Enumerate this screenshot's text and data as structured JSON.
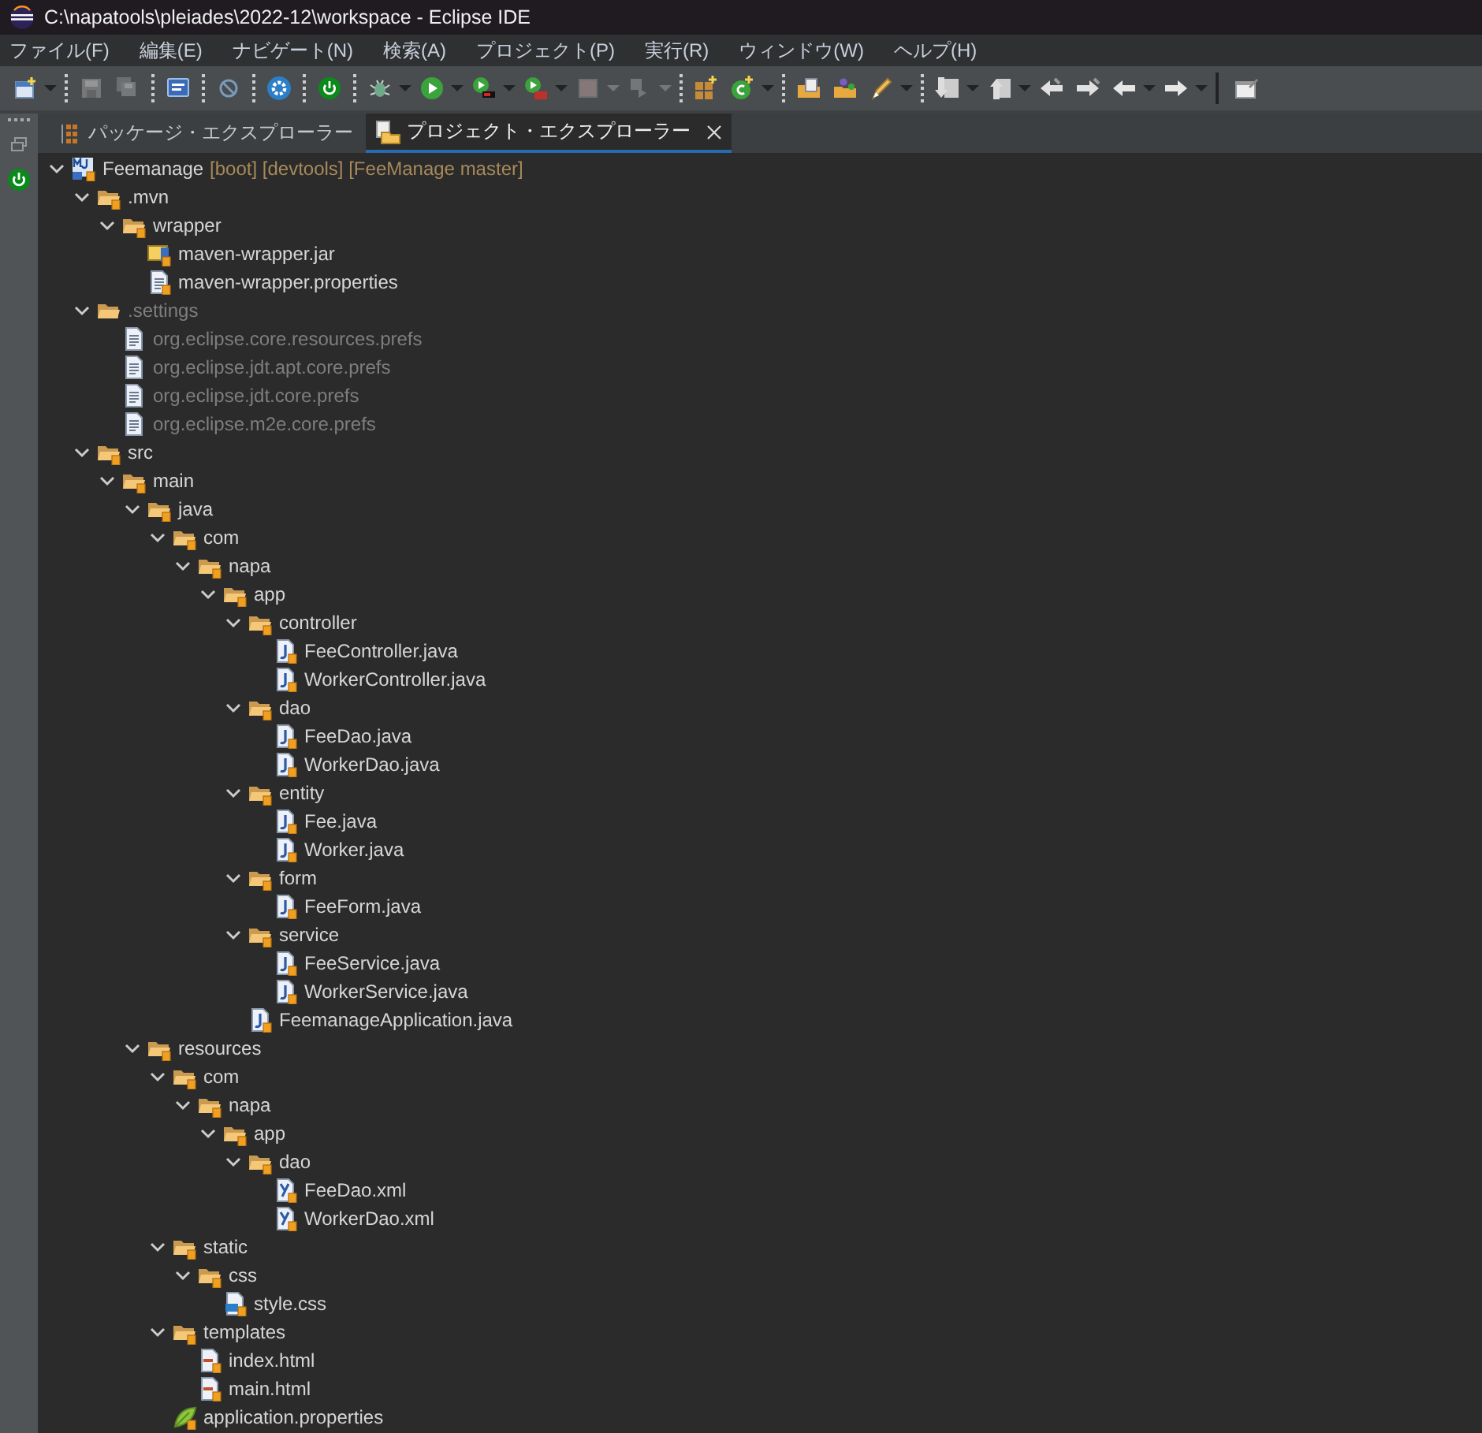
{
  "window": {
    "title": "C:\\napatools\\pleiades\\2022-12\\workspace - Eclipse IDE"
  },
  "menu": [
    {
      "label": "ファイル(F)"
    },
    {
      "label": "編集(E)"
    },
    {
      "label": "ナビゲート(N)"
    },
    {
      "label": "検索(A)"
    },
    {
      "label": "プロジェクト(P)"
    },
    {
      "label": "実行(R)"
    },
    {
      "label": "ウィンドウ(W)"
    },
    {
      "label": "ヘルプ(H)"
    }
  ],
  "toolbar": [
    {
      "kind": "new",
      "dropdown": true,
      "disabled": false
    },
    {
      "kind": "separator"
    },
    {
      "kind": "save",
      "dropdown": false,
      "disabled": true
    },
    {
      "kind": "save-all",
      "dropdown": false,
      "disabled": true
    },
    {
      "kind": "separator"
    },
    {
      "kind": "terminal",
      "dropdown": false,
      "disabled": false
    },
    {
      "kind": "separator"
    },
    {
      "kind": "skip",
      "dropdown": false,
      "disabled": false
    },
    {
      "kind": "separator"
    },
    {
      "kind": "gear",
      "dropdown": false,
      "disabled": false
    },
    {
      "kind": "separator"
    },
    {
      "kind": "power",
      "dropdown": false,
      "disabled": false
    },
    {
      "kind": "separator"
    },
    {
      "kind": "bug",
      "dropdown": true,
      "disabled": false
    },
    {
      "kind": "run",
      "dropdown": true,
      "disabled": false
    },
    {
      "kind": "coverage",
      "dropdown": true,
      "disabled": false
    },
    {
      "kind": "run-tool",
      "dropdown": true,
      "disabled": false
    },
    {
      "kind": "stop",
      "dropdown": true,
      "disabled": true
    },
    {
      "kind": "step",
      "dropdown": true,
      "disabled": true
    },
    {
      "kind": "separator"
    },
    {
      "kind": "new-package",
      "dropdown": false,
      "disabled": false
    },
    {
      "kind": "new-class",
      "dropdown": true,
      "disabled": false
    },
    {
      "kind": "separator"
    },
    {
      "kind": "open-type",
      "dropdown": false,
      "disabled": false
    },
    {
      "kind": "open-task",
      "dropdown": false,
      "disabled": false
    },
    {
      "kind": "pen",
      "dropdown": true,
      "disabled": false
    },
    {
      "kind": "separator"
    },
    {
      "kind": "next-annotation",
      "dropdown": true,
      "disabled": false
    },
    {
      "kind": "prev-annotation",
      "dropdown": true,
      "disabled": false
    },
    {
      "kind": "back-edit",
      "dropdown": false,
      "disabled": false
    },
    {
      "kind": "forward-edit",
      "dropdown": false,
      "disabled": false
    },
    {
      "kind": "back",
      "dropdown": true,
      "disabled": false
    },
    {
      "kind": "forward",
      "dropdown": true,
      "disabled": false
    },
    {
      "kind": "bar"
    },
    {
      "kind": "pin",
      "dropdown": false,
      "disabled": false
    }
  ],
  "tabs": [
    {
      "label": "パッケージ・エクスプローラー",
      "kind": "package",
      "selected": false,
      "closable": false
    },
    {
      "label": "プロジェクト・エクスプローラー",
      "kind": "project",
      "selected": true,
      "closable": true
    }
  ],
  "tree": [
    {
      "label": "Feemanage",
      "decoration": "[boot] [devtools] [FeeManage master]",
      "kind": "project",
      "expanded": true,
      "ignored": false,
      "children": [
        {
          "label": ".mvn",
          "kind": "folder",
          "expanded": true,
          "ignored": false,
          "children": [
            {
              "label": "wrapper",
              "kind": "folder",
              "expanded": true,
              "ignored": false,
              "children": [
                {
                  "label": "maven-wrapper.jar",
                  "kind": "jar",
                  "ignored": false
                },
                {
                  "label": "maven-wrapper.properties",
                  "kind": "text",
                  "ignored": false
                }
              ]
            }
          ]
        },
        {
          "label": ".settings",
          "kind": "open-folder",
          "expanded": true,
          "ignored": true,
          "children": [
            {
              "label": "org.eclipse.core.resources.prefs",
              "kind": "prefs",
              "ignored": true
            },
            {
              "label": "org.eclipse.jdt.apt.core.prefs",
              "kind": "prefs",
              "ignored": true
            },
            {
              "label": "org.eclipse.jdt.core.prefs",
              "kind": "prefs",
              "ignored": true
            },
            {
              "label": "org.eclipse.m2e.core.prefs",
              "kind": "prefs",
              "ignored": true
            }
          ]
        },
        {
          "label": "src",
          "kind": "folder",
          "expanded": true,
          "ignored": false,
          "children": [
            {
              "label": "main",
              "kind": "folder",
              "expanded": true,
              "ignored": false,
              "children": [
                {
                  "label": "java",
                  "kind": "folder",
                  "expanded": true,
                  "ignored": false,
                  "children": [
                    {
                      "label": "com",
                      "kind": "folder",
                      "expanded": true,
                      "ignored": false,
                      "children": [
                        {
                          "label": "napa",
                          "kind": "folder",
                          "expanded": true,
                          "ignored": false,
                          "children": [
                            {
                              "label": "app",
                              "kind": "folder",
                              "expanded": true,
                              "ignored": false,
                              "children": [
                                {
                                  "label": "controller",
                                  "kind": "folder",
                                  "expanded": true,
                                  "ignored": false,
                                  "children": [
                                    {
                                      "label": "FeeController.java",
                                      "kind": "java",
                                      "ignored": false
                                    },
                                    {
                                      "label": "WorkerController.java",
                                      "kind": "java",
                                      "ignored": false
                                    }
                                  ]
                                },
                                {
                                  "label": "dao",
                                  "kind": "folder",
                                  "expanded": true,
                                  "ignored": false,
                                  "children": [
                                    {
                                      "label": "FeeDao.java",
                                      "kind": "java",
                                      "ignored": false
                                    },
                                    {
                                      "label": "WorkerDao.java",
                                      "kind": "java",
                                      "ignored": false
                                    }
                                  ]
                                },
                                {
                                  "label": "entity",
                                  "kind": "folder",
                                  "expanded": true,
                                  "ignored": false,
                                  "children": [
                                    {
                                      "label": "Fee.java",
                                      "kind": "java",
                                      "ignored": false
                                    },
                                    {
                                      "label": "Worker.java",
                                      "kind": "java",
                                      "ignored": false
                                    }
                                  ]
                                },
                                {
                                  "label": "form",
                                  "kind": "folder",
                                  "expanded": true,
                                  "ignored": false,
                                  "children": [
                                    {
                                      "label": "FeeForm.java",
                                      "kind": "java",
                                      "ignored": false
                                    }
                                  ]
                                },
                                {
                                  "label": "service",
                                  "kind": "folder",
                                  "expanded": true,
                                  "ignored": false,
                                  "children": [
                                    {
                                      "label": "FeeService.java",
                                      "kind": "java",
                                      "ignored": false
                                    },
                                    {
                                      "label": "WorkerService.java",
                                      "kind": "java",
                                      "ignored": false
                                    }
                                  ]
                                },
                                {
                                  "label": "FeemanageApplication.java",
                                  "kind": "java",
                                  "ignored": false
                                }
                              ]
                            }
                          ]
                        }
                      ]
                    }
                  ]
                },
                {
                  "label": "resources",
                  "kind": "folder",
                  "expanded": true,
                  "ignored": false,
                  "children": [
                    {
                      "label": "com",
                      "kind": "folder",
                      "expanded": true,
                      "ignored": false,
                      "children": [
                        {
                          "label": "napa",
                          "kind": "folder",
                          "expanded": true,
                          "ignored": false,
                          "children": [
                            {
                              "label": "app",
                              "kind": "folder",
                              "expanded": true,
                              "ignored": false,
                              "children": [
                                {
                                  "label": "dao",
                                  "kind": "folder",
                                  "expanded": true,
                                  "ignored": false,
                                  "children": [
                                    {
                                      "label": "FeeDao.xml",
                                      "kind": "xml",
                                      "ignored": false
                                    },
                                    {
                                      "label": "WorkerDao.xml",
                                      "kind": "xml",
                                      "ignored": false
                                    }
                                  ]
                                }
                              ]
                            }
                          ]
                        }
                      ]
                    },
                    {
                      "label": "static",
                      "kind": "folder",
                      "expanded": true,
                      "ignored": false,
                      "children": [
                        {
                          "label": "css",
                          "kind": "folder",
                          "expanded": true,
                          "ignored": false,
                          "children": [
                            {
                              "label": "style.css",
                              "kind": "css",
                              "ignored": false
                            }
                          ]
                        }
                      ]
                    },
                    {
                      "label": "templates",
                      "kind": "folder",
                      "expanded": true,
                      "ignored": false,
                      "children": [
                        {
                          "label": "index.html",
                          "kind": "html",
                          "ignored": false
                        },
                        {
                          "label": "main.html",
                          "kind": "html",
                          "ignored": false
                        }
                      ]
                    },
                    {
                      "label": "application.properties",
                      "kind": "spring",
                      "ignored": false
                    }
                  ]
                }
              ]
            }
          ]
        }
      ]
    }
  ]
}
